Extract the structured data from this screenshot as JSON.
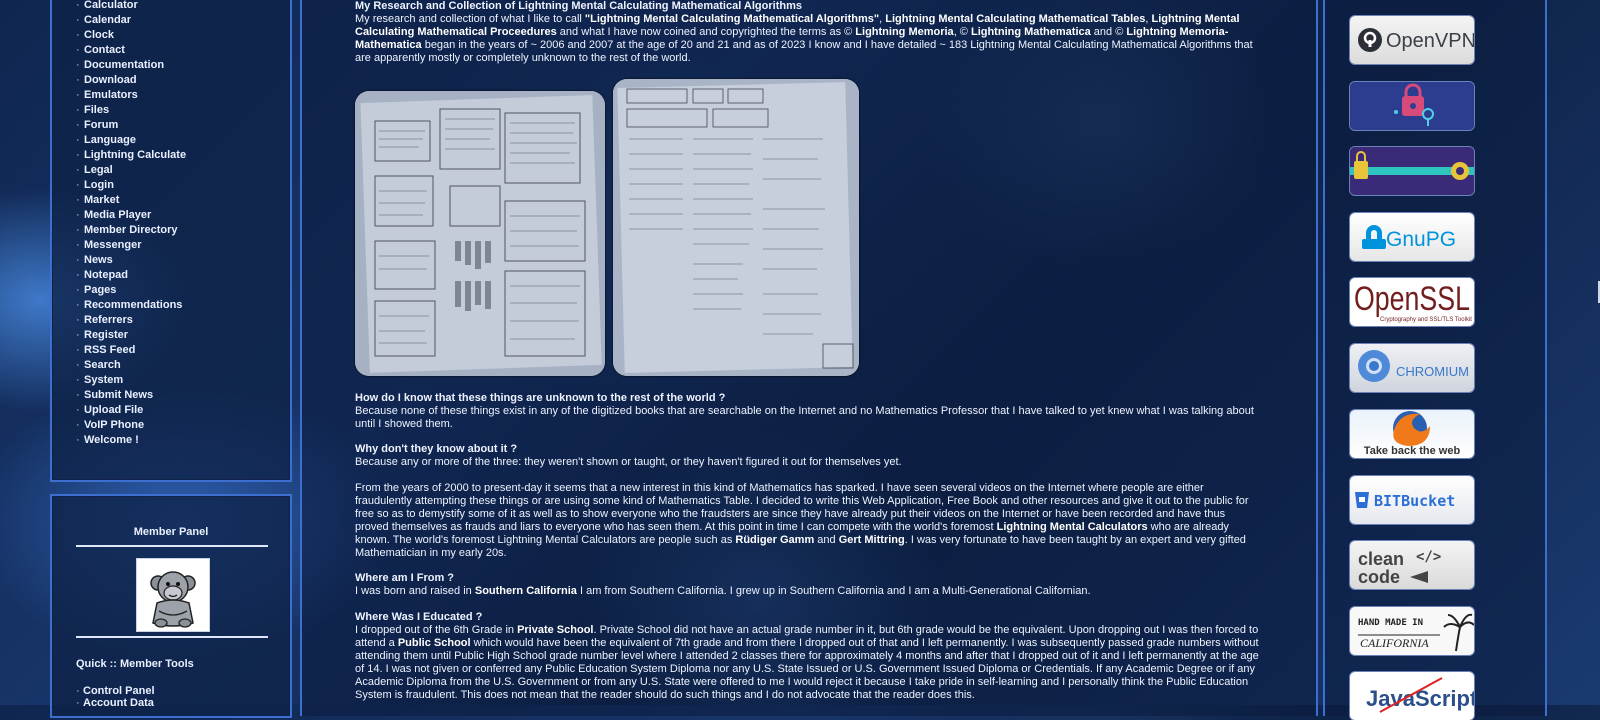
{
  "nav": {
    "items": [
      "Calculator",
      "Calendar",
      "Clock",
      "Contact",
      "Documentation",
      "Download",
      "Emulators",
      "Files",
      "Forum",
      "Language",
      "Lightning Calculate",
      "Legal",
      "Login",
      "Market",
      "Media Player",
      "Member Directory",
      "Messenger",
      "News",
      "Notepad",
      "Pages",
      "Recommendations",
      "Referrers",
      "Register",
      "RSS Feed",
      "Search",
      "System",
      "Submit News",
      "Upload File",
      "VoIP Phone",
      "Welcome !"
    ]
  },
  "member": {
    "title": "Member Panel",
    "quick_title": "Quick :: Member Tools",
    "tools": [
      "Control Panel",
      "Account Data"
    ]
  },
  "article": {
    "heading": "My Research and Collection of Lightning Mental Calculating Mathematical Algorithms",
    "intro": {
      "t1": "My research and collection of what I like to call ",
      "b1": "\"Lightning Mental Calculating Mathematical Algorithms\"",
      "t2": ", ",
      "b2": "Lightning Mental Calculating Mathematical Tables",
      "t3": ", ",
      "b3": "Lightning Mental Calculating Mathematical Proceedures",
      "t4": " and what I have now coined and copyrighted the terms as © ",
      "b4": "Lightning Memoria",
      "t5": ", © ",
      "b5": "Lightning Mathematica",
      "t6": " and © ",
      "b6": "Lightning Memoria-Mathematica",
      "t7": " began in the years of ~ 2006 and 2007 at the age of 20 and 21 and as of 2023 I know and I have detailed ~ 183 Lightning Mental Calculating Mathematical Algorithms that are apparently mostly or completely unknown to the rest of the world."
    },
    "q1": "How do I know that these things are unknown to the rest of the world ?",
    "a1": "Because none of these things exist in any of the digitized books that are searchable on the Internet and no Mathematics Professor that I have talked to yet knew what I was talking about until I showed them.",
    "q2": "Why don't they know about it ?",
    "a2": "Because any or more of the three: they weren't shown or taught, or they haven't figured it out for themselves yet.",
    "p3": {
      "t1": "From the years of 2000 to present-day it seems that a new interest in this kind of Mathematics has sparked. I have seen several videos on the Internet where people are either fraudulently attempting these things or are using some kind of Mathematics Table. I decided to write this Web Application, Free Book and other resources and give it out to the public for free so as to demystify some of it as well as to show everyone who the fraudsters are since they have already put their videos on the Internet or have been recorded and have thus proved themselves as frauds and liars to everyone who has seen them. At this point in time I can compete with the world's foremost ",
      "b1": "Lightning Mental Calculators",
      "t2": " who are already known. The world's foremost Lightning Mental Calculators are people such as ",
      "b2": "Rüdiger Gamm",
      "t3": " and ",
      "b3": "Gert Mittring",
      "t4": ". I was very fortunate to have been taught by an expert and very gifted Mathematician in my early 20s."
    },
    "q4": "Where am I From ?",
    "a4": {
      "t1": "I was born and raised in ",
      "b1": "Southern California",
      "t2": " I am from Southern California. I grew up in Southern California and I am a Multi-Generational Californian."
    },
    "q5": "Where Was I Educated ?",
    "a5": {
      "t1": "I dropped out of the 6th Grade in ",
      "b1": "Private School",
      "t2": ". Private School did not have an actual grade number in it, but 6th grade would be the equivalent. Upon dropping out I was then forced to attend a ",
      "b2": "Public School",
      "t3": " which would have been the equivalent of 7th grade and from there I dropped out of that and I left permanently. I was subsequently passed grade numbers without attending them until Public High School grade number level where I attended 2 classes there for approximately 4 months and after that I dropped out of it and I left permanently at the age of 14. I was not given or conferred any Public Education System Diploma nor any U.S. State Issued or U.S. Government Issued Diploma or Credentials. If any Academic Degree or if any Academic Diploma from the U.S. Government or from any U.S. State were offered to me I would reject it because I take pride in self-learning and I personally think the Public Education System is fraudulent. This does not mean that the reader should do such things and I do not advocate that the reader does this."
    }
  },
  "badges": {
    "openvpn": "OpenVPN",
    "gnupg": "GnuPG",
    "openssl": "OpenSSL",
    "openssl_sub": "Cryptography and SSL/TLS Toolkit",
    "chromium": "CHROMIUM",
    "firefox": "Take back the web",
    "bitbucket": "BITBucket",
    "cleancode_1": "clean",
    "cleancode_2": "code",
    "cleancode_tag": "</>",
    "handmade_1": "HAND MADE IN",
    "handmade_2": "CALIFORNIA",
    "javascript": "JavaScript"
  },
  "colors": {
    "page_bg": "#132c5a",
    "panel_border": "#3d6fd0",
    "text": "#eef3ff"
  }
}
